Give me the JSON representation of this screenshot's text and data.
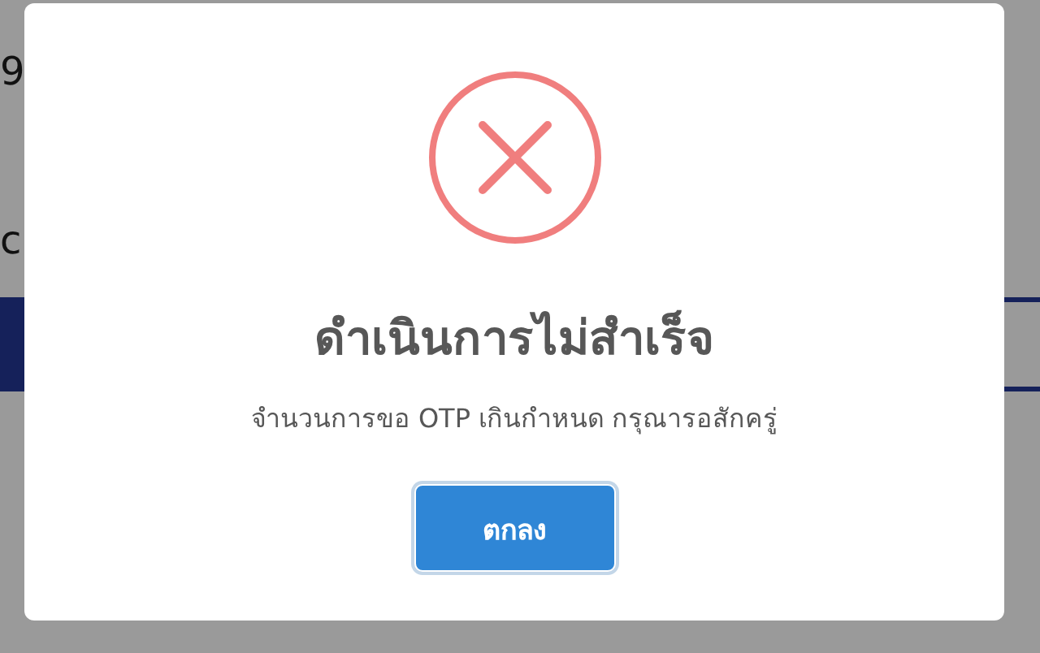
{
  "background": {
    "texts": [
      "9",
      "c"
    ]
  },
  "dialog": {
    "kind": "error",
    "title": "ดำเนินการไม่สำเร็จ",
    "message": "จำนวนการขอ OTP เกินกำหนด กรุณารอสักครู่",
    "buttons": [
      {
        "label": "ตกลง"
      }
    ]
  }
}
